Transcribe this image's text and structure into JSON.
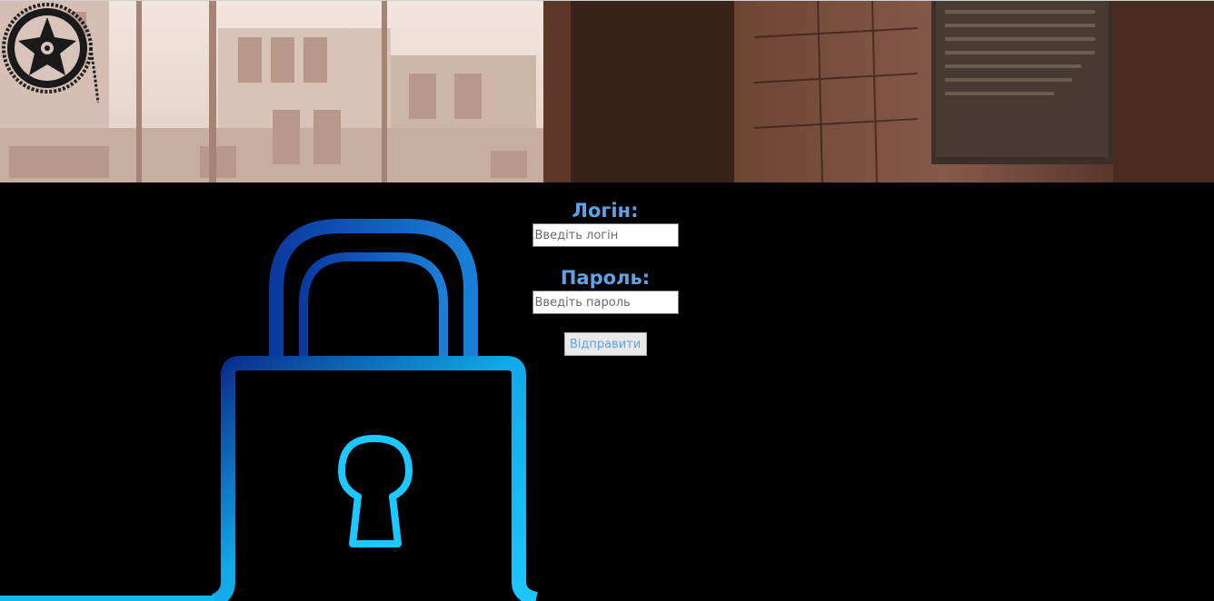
{
  "banner": {
    "image_name": "old-building-photo",
    "logo_icon": "gear-chain-logo-icon"
  },
  "illustration": {
    "icon": "padlock-icon",
    "colors": {
      "dark": "#0a2a8a",
      "light": "#10c0f8"
    }
  },
  "login_form": {
    "login_label": "Логін:",
    "login_placeholder": "Введіть логін",
    "login_value": "",
    "password_label": "Пароль:",
    "password_placeholder": "Введіть пароль",
    "password_value": "",
    "submit_label": "Відправити"
  },
  "colors": {
    "label": "#5fa2e6",
    "background": "#000000"
  }
}
